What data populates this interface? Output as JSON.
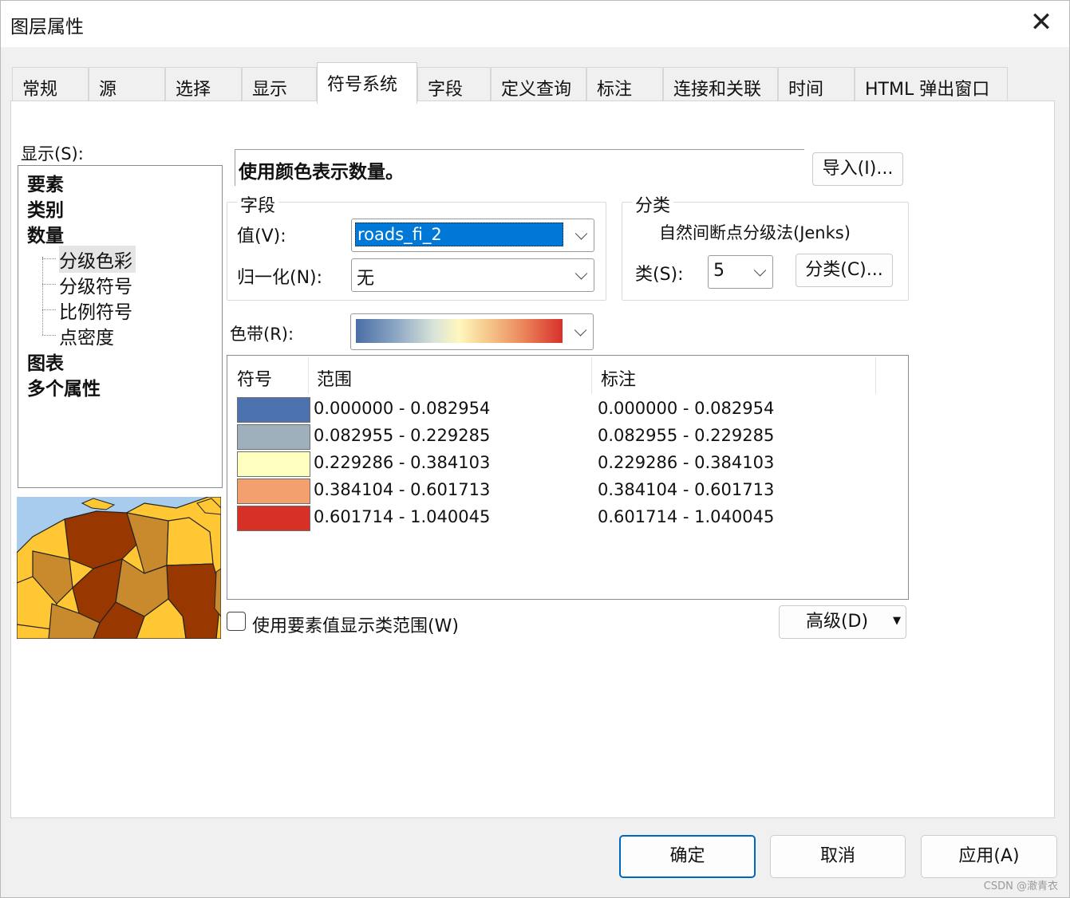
{
  "dialog": {
    "title": "图层属性",
    "close_glyph": "✕"
  },
  "tabs": [
    {
      "label": "常规"
    },
    {
      "label": "源"
    },
    {
      "label": "选择"
    },
    {
      "label": "显示"
    },
    {
      "label": "符号系统",
      "active": true
    },
    {
      "label": "字段"
    },
    {
      "label": "定义查询"
    },
    {
      "label": "标注"
    },
    {
      "label": "连接和关联"
    },
    {
      "label": "时间"
    },
    {
      "label": "HTML 弹出窗口"
    }
  ],
  "show_panel": {
    "label": "显示(S):",
    "items": [
      {
        "label": "要素"
      },
      {
        "label": "类别"
      },
      {
        "label": "数量"
      },
      {
        "label": "分级色彩",
        "selected": true
      },
      {
        "label": "分级符号"
      },
      {
        "label": "比例符号"
      },
      {
        "label": "点密度"
      },
      {
        "label": "图表"
      },
      {
        "label": "多个属性"
      }
    ]
  },
  "description": "使用颜色表示数量。",
  "import_button": "导入(I)...",
  "field_group": {
    "title": "字段",
    "value_label": "值(V):",
    "value_selected": "roads_fi_2",
    "normalize_label": "归一化(N):",
    "normalize_value": "无"
  },
  "classification_group": {
    "title": "分类",
    "method": "自然间断点分级法(Jenks)",
    "classes_label": "类(S):",
    "classes_value": "5",
    "classify_button": "分类(C)..."
  },
  "color_ramp": {
    "label": "色带(R):"
  },
  "legend_table": {
    "headers": {
      "symbol": "符号",
      "range": "范围",
      "label": "标注"
    },
    "rows": [
      {
        "color": "#4c72b0",
        "range": "0.000000 - 0.082954",
        "label": "0.000000 - 0.082954"
      },
      {
        "color": "#9fb0bd",
        "range": "0.082955 - 0.229285",
        "label": "0.082955 - 0.229285"
      },
      {
        "color": "#ffffc0",
        "range": "0.229286 - 0.384103",
        "label": "0.229286 - 0.384103"
      },
      {
        "color": "#f3a06e",
        "range": "0.384104 - 0.601713",
        "label": "0.384104 - 0.601713"
      },
      {
        "color": "#d63027",
        "range": "0.601714 - 1.040045",
        "label": "0.601714 - 1.040045"
      }
    ]
  },
  "use_feature_values": {
    "label": "使用要素值显示类范围(W)",
    "checked": false
  },
  "advanced_button": "高级(D)",
  "footer": {
    "ok": "确定",
    "cancel": "取消",
    "apply": "应用(A)"
  },
  "watermark": "CSDN @澈青衣"
}
